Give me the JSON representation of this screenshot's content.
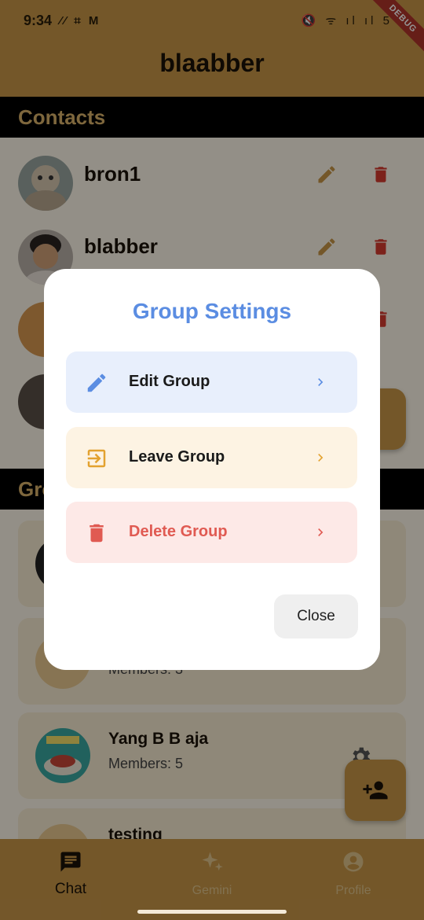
{
  "status_bar": {
    "time": "9:34",
    "left_icons": "⁄⁄ ⌗ M",
    "right_icons": "🔇 ᯤ ıl ıl",
    "battery": "5"
  },
  "debug_banner": "DEBUG",
  "app": {
    "title": "blaabber"
  },
  "contacts": {
    "header": "Contacts",
    "items": [
      {
        "name": "bron1"
      },
      {
        "name": "blabber"
      },
      {
        "name": ""
      },
      {
        "name": ""
      }
    ]
  },
  "groups": {
    "header_visible": "Gro",
    "items": [
      {
        "name": "",
        "members": ""
      },
      {
        "name": "",
        "members": "Members: 3"
      },
      {
        "name": "Yang B B aja",
        "members": "Members: 5"
      },
      {
        "name": "testing",
        "members": ""
      }
    ]
  },
  "dialog": {
    "title": "Group Settings",
    "options": [
      {
        "label": "Edit Group",
        "icon": "pencil-icon",
        "color": "#5b8de2",
        "bg": "#e8effc"
      },
      {
        "label": "Leave Group",
        "icon": "exit-icon",
        "color": "#e3a230",
        "bg": "#fdf3e3"
      },
      {
        "label": "Delete Group",
        "icon": "trash-icon",
        "color": "#e05a52",
        "bg": "#fde9e7"
      }
    ],
    "close_label": "Close"
  },
  "bottom_nav": {
    "items": [
      {
        "label": "Chat",
        "icon": "chat-icon",
        "active": true
      },
      {
        "label": "Gemini",
        "icon": "sparkle-icon",
        "active": false
      },
      {
        "label": "Profile",
        "icon": "profile-icon",
        "active": false
      }
    ]
  },
  "colors": {
    "primary": "#c89648",
    "accent_blue": "#5b8de2",
    "danger": "#e05a52",
    "warning": "#e3a230"
  }
}
